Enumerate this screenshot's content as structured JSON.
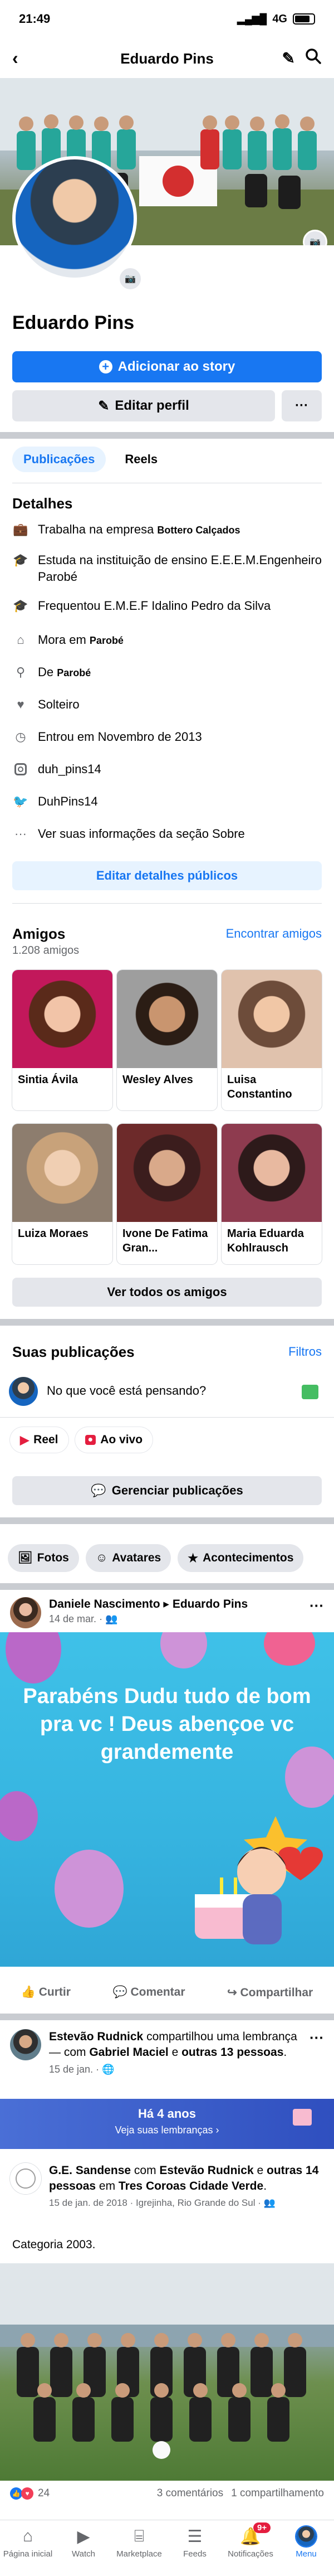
{
  "status_bar": {
    "time": "21:49",
    "network": "4G"
  },
  "header": {
    "title": "Eduardo Pins",
    "back_icon": "chevron-left-icon",
    "edit_icon": "pencil-icon",
    "search_icon": "search-icon"
  },
  "profile": {
    "name": "Eduardo Pins",
    "add_story_label": "Adicionar ao story",
    "edit_profile_label": "Editar perfil",
    "more_label": "···"
  },
  "tabs": [
    "Publicações",
    "Reels"
  ],
  "details": {
    "title": "Detalhes",
    "rows": [
      {
        "icon": "briefcase-icon",
        "text": "Trabalha na empresa ",
        "bold": "Bottero Calçados"
      },
      {
        "icon": "graduation-cap-icon",
        "text": "Estuda na instituição de ensino E.E.E.M.Engenheiro Parobé",
        "bold": ""
      },
      {
        "icon": "graduation-cap-icon",
        "text": "Frequentou E.M.E.F Idalino Pedro da Silva",
        "bold": ""
      },
      {
        "icon": "home-icon",
        "text": "Mora em ",
        "bold": "Parobé"
      },
      {
        "icon": "location-pin-icon",
        "text": "De ",
        "bold": "Parobé"
      },
      {
        "icon": "heart-icon",
        "text": "Solteiro",
        "bold": ""
      },
      {
        "icon": "clock-icon",
        "text": "Entrou em Novembro de 2013",
        "bold": ""
      },
      {
        "icon": "instagram-icon",
        "text": "duh_pins14",
        "bold": ""
      },
      {
        "icon": "twitter-icon",
        "text": "DuhPins14",
        "bold": ""
      },
      {
        "icon": "ellipsis-icon",
        "text": "Ver suas informações da seção Sobre",
        "bold": ""
      }
    ],
    "edit_button": "Editar detalhes públicos"
  },
  "friends": {
    "title": "Amigos",
    "count": "1.208 amigos",
    "find_link": "Encontrar amigos",
    "items": [
      {
        "name": "Sintia Ávila",
        "color": "#c2185b"
      },
      {
        "name": "Wesley Alves",
        "color": "#5d4037"
      },
      {
        "name": "Luisa Constantino",
        "color": "#d7a98c"
      },
      {
        "name": "Luiza Moraes",
        "color": "#c8a27a"
      },
      {
        "name": "Ivone De Fatima Gran...",
        "color": "#6d2a2a"
      },
      {
        "name": "Maria Eduarda Kohlrausch",
        "color": "#8e3b4f"
      }
    ],
    "see_all_label": "Ver todos os amigos"
  },
  "publications": {
    "title": "Suas publicações",
    "filter_label": "Filtros",
    "composer_placeholder": "No que você está pensando?",
    "reel_label": "Reel",
    "live_label": "Ao vivo",
    "manage_label": "Gerenciar publicações",
    "chips": [
      "Fotos",
      "Avatares",
      "Acontecimentos"
    ]
  },
  "post1": {
    "author": "Daniele Nascimento",
    "target": "Eduardo Pins",
    "time": "14 de mar.",
    "image_text": "Parabéns Dudu tudo de bom pra vc ! Deus abençoe vc grandemente",
    "image_highlight": "Parabéns",
    "actions": [
      "Curtir",
      "Comentar",
      "Compartilhar"
    ]
  },
  "post2": {
    "author": "Estevão Rudnick",
    "text1": " compartilhou uma lembrança — com ",
    "tag1": "Gabriel Maciel",
    "text2": " e ",
    "tag2": "outras 13 pessoas",
    "end": ".",
    "time": "15 de jan.",
    "memory_title": "Há 4 anos",
    "memory_sub": "Veja suas lembranças",
    "shared_author": "G.E. Sandense",
    "shared_text1": " com ",
    "shared_tag1": "Estevão Rudnick",
    "shared_text2": " e ",
    "shared_tag2": "outras 14 pessoas",
    "shared_text3": " em ",
    "shared_place": "Tres Coroas Cidade Verde",
    "shared_meta": "15 de jan. de 2018 · Igrejinha, Rio Grande do Sul",
    "caption": "Categoria 2003.",
    "reactions_count": "24",
    "comments": "3 comentários",
    "shares": "1 compartilhamento"
  },
  "bottom_nav": {
    "items": [
      {
        "label": "Página inicial",
        "icon": "home-icon"
      },
      {
        "label": "Watch",
        "icon": "video-icon"
      },
      {
        "label": "Marketplace",
        "icon": "store-icon"
      },
      {
        "label": "Feeds",
        "icon": "feeds-icon"
      },
      {
        "label": "Notificações",
        "icon": "bell-icon",
        "badge": "9+"
      },
      {
        "label": "Menu",
        "icon": "menu-avatar-icon"
      }
    ]
  },
  "colors": {
    "brand": "#1877f2",
    "divider": "#c9ccd1",
    "badge": "#e41e3f"
  }
}
